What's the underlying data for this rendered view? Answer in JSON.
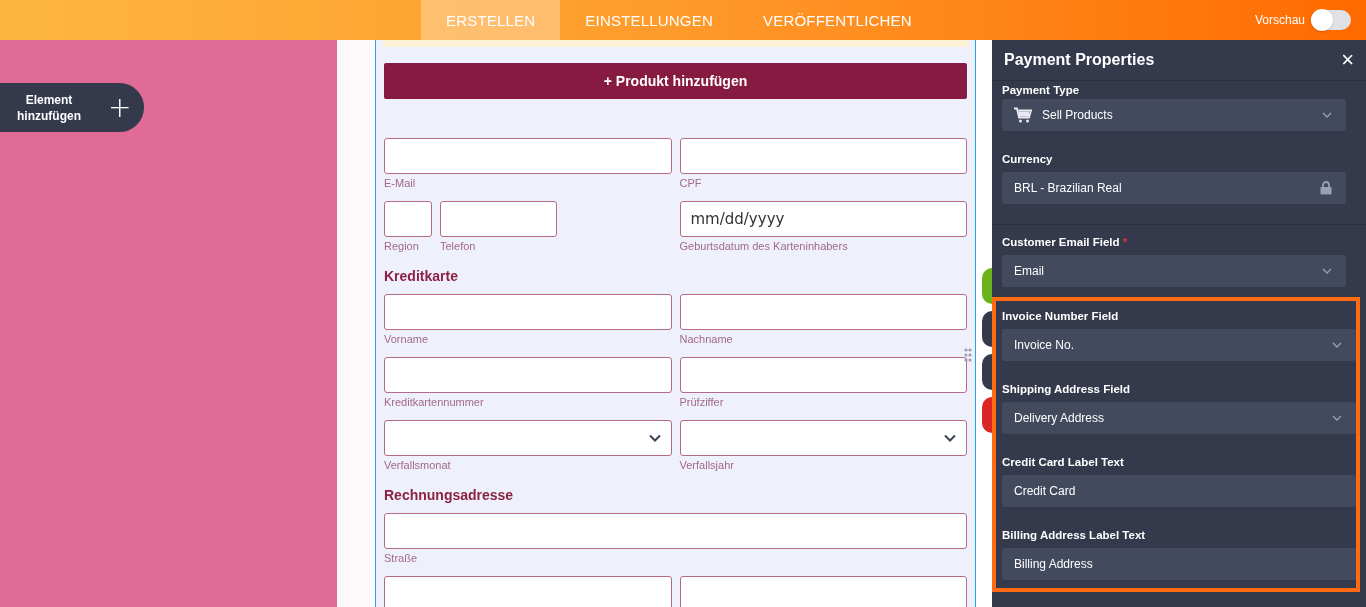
{
  "topbar": {
    "tabs": [
      {
        "label": "ERSTELLEN",
        "selected": true
      },
      {
        "label": "EINSTELLUNGEN",
        "selected": false
      },
      {
        "label": "VERÖFFENTLICHEN",
        "selected": false
      }
    ],
    "preview": {
      "label": "Vorschau",
      "on": false
    }
  },
  "add_element": {
    "label": "Element hinzufügen",
    "icon": "+"
  },
  "form": {
    "add_product": "+ Produkt hinzufügen",
    "items": [
      {
        "kind": "fields",
        "columns": [
          [
            {
              "kind": "text",
              "label": "E-Mail"
            }
          ],
          [
            {
              "kind": "text",
              "label": "CPF"
            }
          ]
        ]
      },
      {
        "kind": "fields",
        "columns": [
          [
            {
              "kind": "short",
              "label": "Region"
            },
            {
              "kind": "medium",
              "label": "Telefon"
            }
          ],
          [
            {
              "kind": "date",
              "label": "Geburtsdatum des Karteninhabers",
              "placeholder": "mm/dd/yyyy"
            }
          ]
        ]
      },
      {
        "kind": "heading",
        "text": "Kreditkarte"
      },
      {
        "kind": "fields",
        "columns": [
          [
            {
              "kind": "text",
              "label": "Vorname"
            }
          ],
          [
            {
              "kind": "text",
              "label": "Nachname"
            }
          ]
        ]
      },
      {
        "kind": "fields",
        "columns": [
          [
            {
              "kind": "text",
              "label": "Kreditkartennummer"
            }
          ],
          [
            {
              "kind": "text",
              "label": "Prüfziffer"
            }
          ]
        ]
      },
      {
        "kind": "fields",
        "columns": [
          [
            {
              "kind": "select",
              "label": "Verfallsmonat"
            }
          ],
          [
            {
              "kind": "select",
              "label": "Verfallsjahr"
            }
          ]
        ]
      },
      {
        "kind": "heading",
        "text": "Rechnungsadresse"
      },
      {
        "kind": "wide",
        "label": "Straße"
      },
      {
        "kind": "fields",
        "columns": [
          [
            {
              "kind": "text"
            }
          ],
          [
            {
              "kind": "text"
            }
          ]
        ]
      }
    ]
  },
  "side_buttons": [
    {
      "color": "#6bb31a"
    },
    {
      "color": "#343a4c"
    },
    {
      "color": "#343a4c"
    },
    {
      "color": "#dc2626"
    }
  ],
  "panel": {
    "title": "Payment Properties",
    "close": "×",
    "sections": [
      {
        "highlighted": false,
        "props": [
          {
            "label": "Payment Type",
            "kind": "cartselect",
            "value": "Sell Products"
          },
          {
            "label": "Currency",
            "kind": "locked",
            "value": "BRL - Brazilian Real"
          }
        ]
      },
      {
        "highlighted": false,
        "props": [
          {
            "label": "Customer Email Field",
            "kind": "select",
            "value": "Email",
            "marker": "*"
          }
        ]
      },
      {
        "highlighted": true,
        "props": [
          {
            "label": "Invoice Number Field",
            "kind": "select",
            "value": "Invoice No."
          },
          {
            "label": "Shipping Address Field",
            "kind": "select",
            "value": "Delivery Address"
          },
          {
            "label": "Credit Card Label Text",
            "kind": "text",
            "value": "Credit Card"
          },
          {
            "label": "Billing Address Label Text",
            "kind": "text",
            "value": "Billing Address"
          }
        ]
      }
    ]
  }
}
